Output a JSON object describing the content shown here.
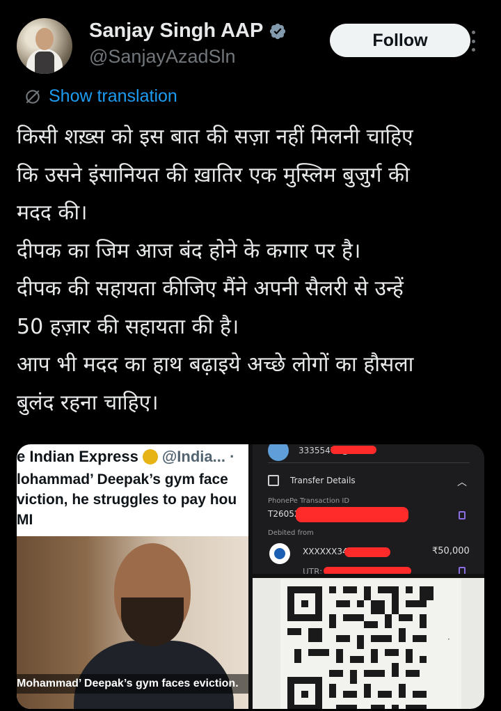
{
  "author": {
    "name": "Sanjay Singh AAP",
    "handle": "@SanjayAzadSln",
    "verified_icon": "verified-badge-icon",
    "follow_label": "Follow"
  },
  "translation": {
    "label": "Show translation"
  },
  "tweet": {
    "lines": [
      "किसी शख़्स को इस बात की सज़ा नहीं मिलनी चाहिए",
      "कि उसने इंसानियत की ख़ातिर एक मुस्लिम बुजुर्ग की",
      "मदद की।",
      "दीपक का जिम आज  बंद होने के कगार पर है।",
      "दीपक की सहायता कीजिए मैंने अपनी सैलरी से उन्हें",
      "50 हज़ार की सहायता की है।",
      "आप भी मदद का हाथ बढ़ाइये अच्छे लोगों का हौसला",
      "बुलंद रहना चाहिए।"
    ]
  },
  "media": {
    "news": {
      "source": "e Indian Express",
      "handle": "@India... · ",
      "headline": [
        "lohammad’ Deepak’s gym face",
        "viction, he struggles to pay hou",
        "MI"
      ],
      "caption": "Mohammad’ Deepak’s gym faces eviction."
    },
    "payment": {
      "account_partial": "3335547a@b",
      "section_title": "Transfer Details",
      "txn_label": "PhonePe Transaction ID",
      "txn_value": "T26052",
      "debited_label": "Debited from",
      "debited_account": "XXXXXX34",
      "amount": "₹50,000",
      "utr_label": "UTR: "
    }
  },
  "colors": {
    "background": "#000000",
    "text": "#e7e9ea",
    "muted": "#71767b",
    "link": "#1d9bf0",
    "verified": "#829aab"
  }
}
